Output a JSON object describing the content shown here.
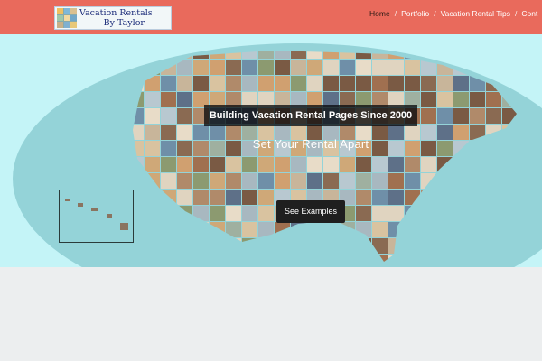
{
  "header": {
    "logo_line1": "Vacation Rentals",
    "logo_line2": "By Taylor",
    "nav": [
      "Home",
      "Portfolio",
      "Vacation Rental Tips",
      "Cont"
    ],
    "separator": "/",
    "background_color": "#e96a5c"
  },
  "hero": {
    "headline": "Building Vacation Rental Pages Since 2000",
    "subheadline": "Set Your Rental Apart",
    "cta_label": "See Examples",
    "background_color": "#c4f4f7",
    "globe_color": "#94d3d8"
  }
}
